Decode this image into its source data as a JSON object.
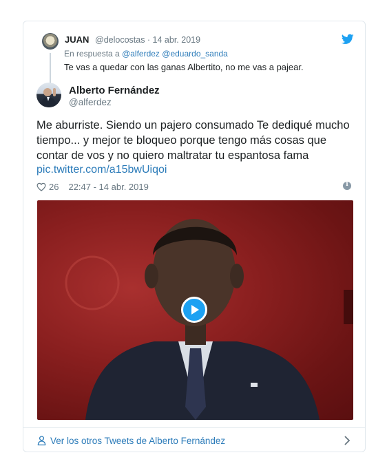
{
  "reply": {
    "name": "JUAN",
    "handle_date": "@delocostas · 14 abr. 2019",
    "in_reply_prefix": "En respuesta a",
    "mentions": "@alferdez @eduardo_sanda",
    "text": "Te vas a quedar con las ganas Albertito, no me vas a pajear."
  },
  "tweet": {
    "name": "Alberto Fernández",
    "handle": "@alferdez",
    "text": "Me aburriste. Siendo un pajero consumado Te dediqué mucho tiempo... y mejor te bloqueo porque tengo más cosas que contar de vos y no quiero maltratar tu espantosa fama",
    "link": "pic.twitter.com/a15bwUiqoi",
    "likes": "26",
    "timestamp": "22:47 - 14 abr. 2019"
  },
  "footer": {
    "label": "Ver los otros Tweets de Alberto Fernández"
  },
  "colors": {
    "link": "#2b7bb9",
    "muted": "#697882",
    "twitter_blue": "#1da1f2",
    "border": "#e1e8ed"
  },
  "icons": [
    "twitter-bird-icon",
    "heart-icon",
    "info-icon",
    "play-icon",
    "person-icon",
    "chevron-right-icon"
  ]
}
